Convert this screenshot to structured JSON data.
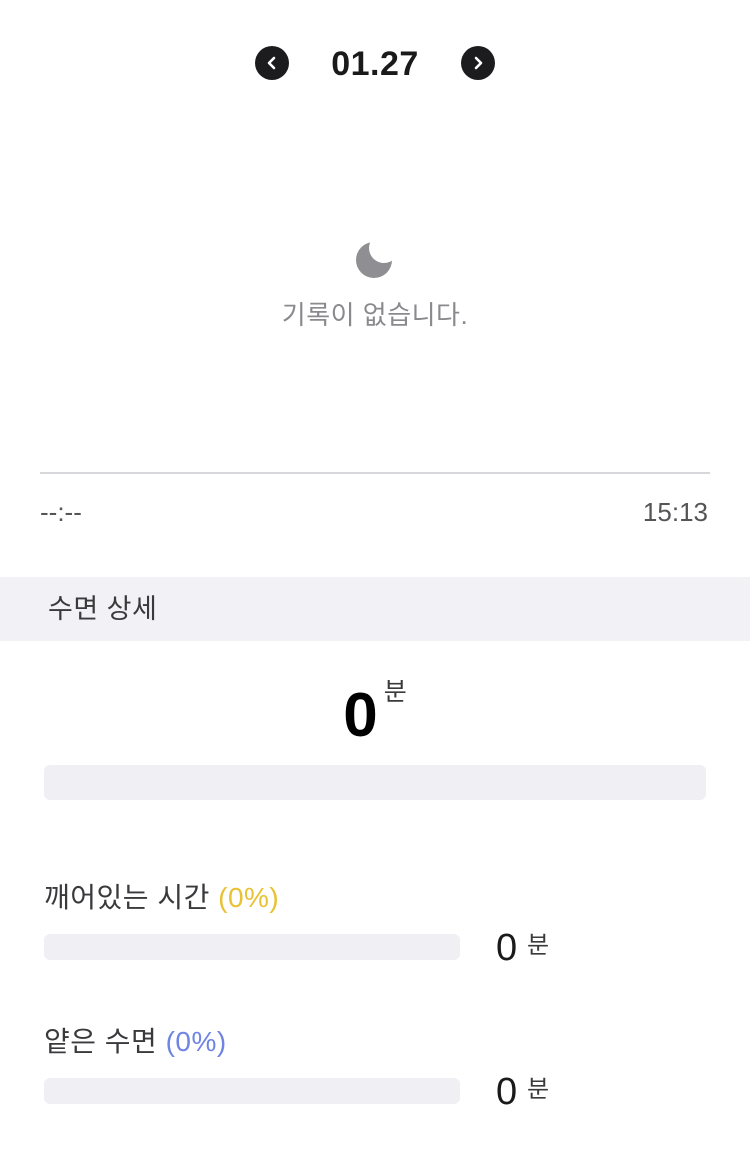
{
  "header": {
    "date": "01.27",
    "prev_icon": "chevron-left-icon",
    "next_icon": "chevron-right-icon"
  },
  "empty_state": {
    "icon": "moon-icon",
    "message": "기록이 없습니다."
  },
  "timeline": {
    "start": "--:--",
    "end": "15:13"
  },
  "section": {
    "title": "수면 상세"
  },
  "total": {
    "value": "0",
    "unit": "분"
  },
  "stages": {
    "awake": {
      "label": "깨어있는 시간",
      "percent": "(0%)",
      "value": "0",
      "unit": "분",
      "fraction": 0,
      "color": "#e8c233"
    },
    "light": {
      "label": "얕은 수면",
      "percent": "(0%)",
      "value": "0",
      "unit": "분",
      "fraction": 0,
      "color": "#6f84e3"
    }
  },
  "colors": {
    "background": "#ffffff",
    "section_background": "#f2f2f6",
    "bar_track": "#f0f0f4",
    "muted_text": "#8a8a8e"
  }
}
